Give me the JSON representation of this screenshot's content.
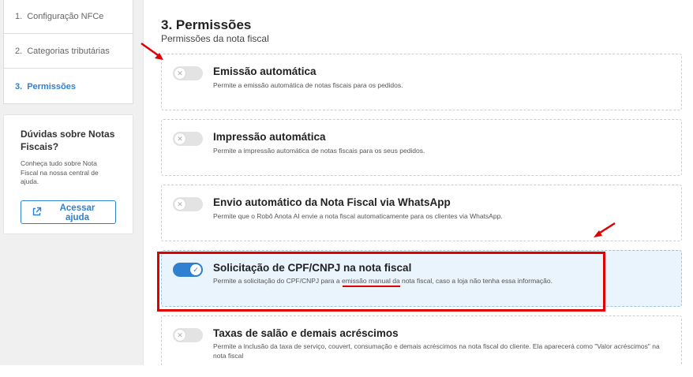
{
  "sidebar": {
    "steps": [
      {
        "num": "1.",
        "label": "Configuração NFCe",
        "active": false
      },
      {
        "num": "2.",
        "label": "Categorias tributárias",
        "active": false
      },
      {
        "num": "3.",
        "label": "Permissões",
        "active": true
      }
    ],
    "help": {
      "title": "Dúvidas sobre Notas Fiscais?",
      "text": "Conheça tudo sobre Nota Fiscal na nossa central de ajuda.",
      "button_label": "Acessar ajuda",
      "button_icon": "external-link-icon"
    }
  },
  "main": {
    "title": "3. Permissões",
    "subtitle": "Permissões da nota fiscal",
    "permissions": [
      {
        "title": "Emissão automática",
        "description": "Permite a emissão automática de notas fiscais para os pedidos.",
        "enabled": false
      },
      {
        "title": "Impressão automática",
        "description": "Permite a impressão automática de notas fiscais para os seus pedidos.",
        "enabled": false
      },
      {
        "title": "Envio automático da Nota Fiscal via WhatsApp",
        "description": "Permite que o Robô Anota AI envie a nota fiscal automaticamente para os clientes via WhatsApp.",
        "enabled": false
      },
      {
        "title": "Solicitação de CPF/CNPJ na nota fiscal",
        "description_before": "Permite a solicitação do CPF/CNPJ para a ",
        "description_highlight": "emissão manual",
        "description_after": " da nota fiscal, caso a loja não tenha essa informação.",
        "enabled": true
      },
      {
        "title": "Taxas de salão e demais acréscimos",
        "description": "Permite a inclusão da taxa de serviço, couvert, consumação e demais acréscimos na nota fiscal do cliente. Ela aparecerá como \"Valor acréscimos\" na nota fiscal",
        "enabled": false
      }
    ]
  },
  "colors": {
    "accent": "#2f80d0",
    "annotation_red": "#e00000",
    "selected_card_bg": "#eaf4fd"
  }
}
